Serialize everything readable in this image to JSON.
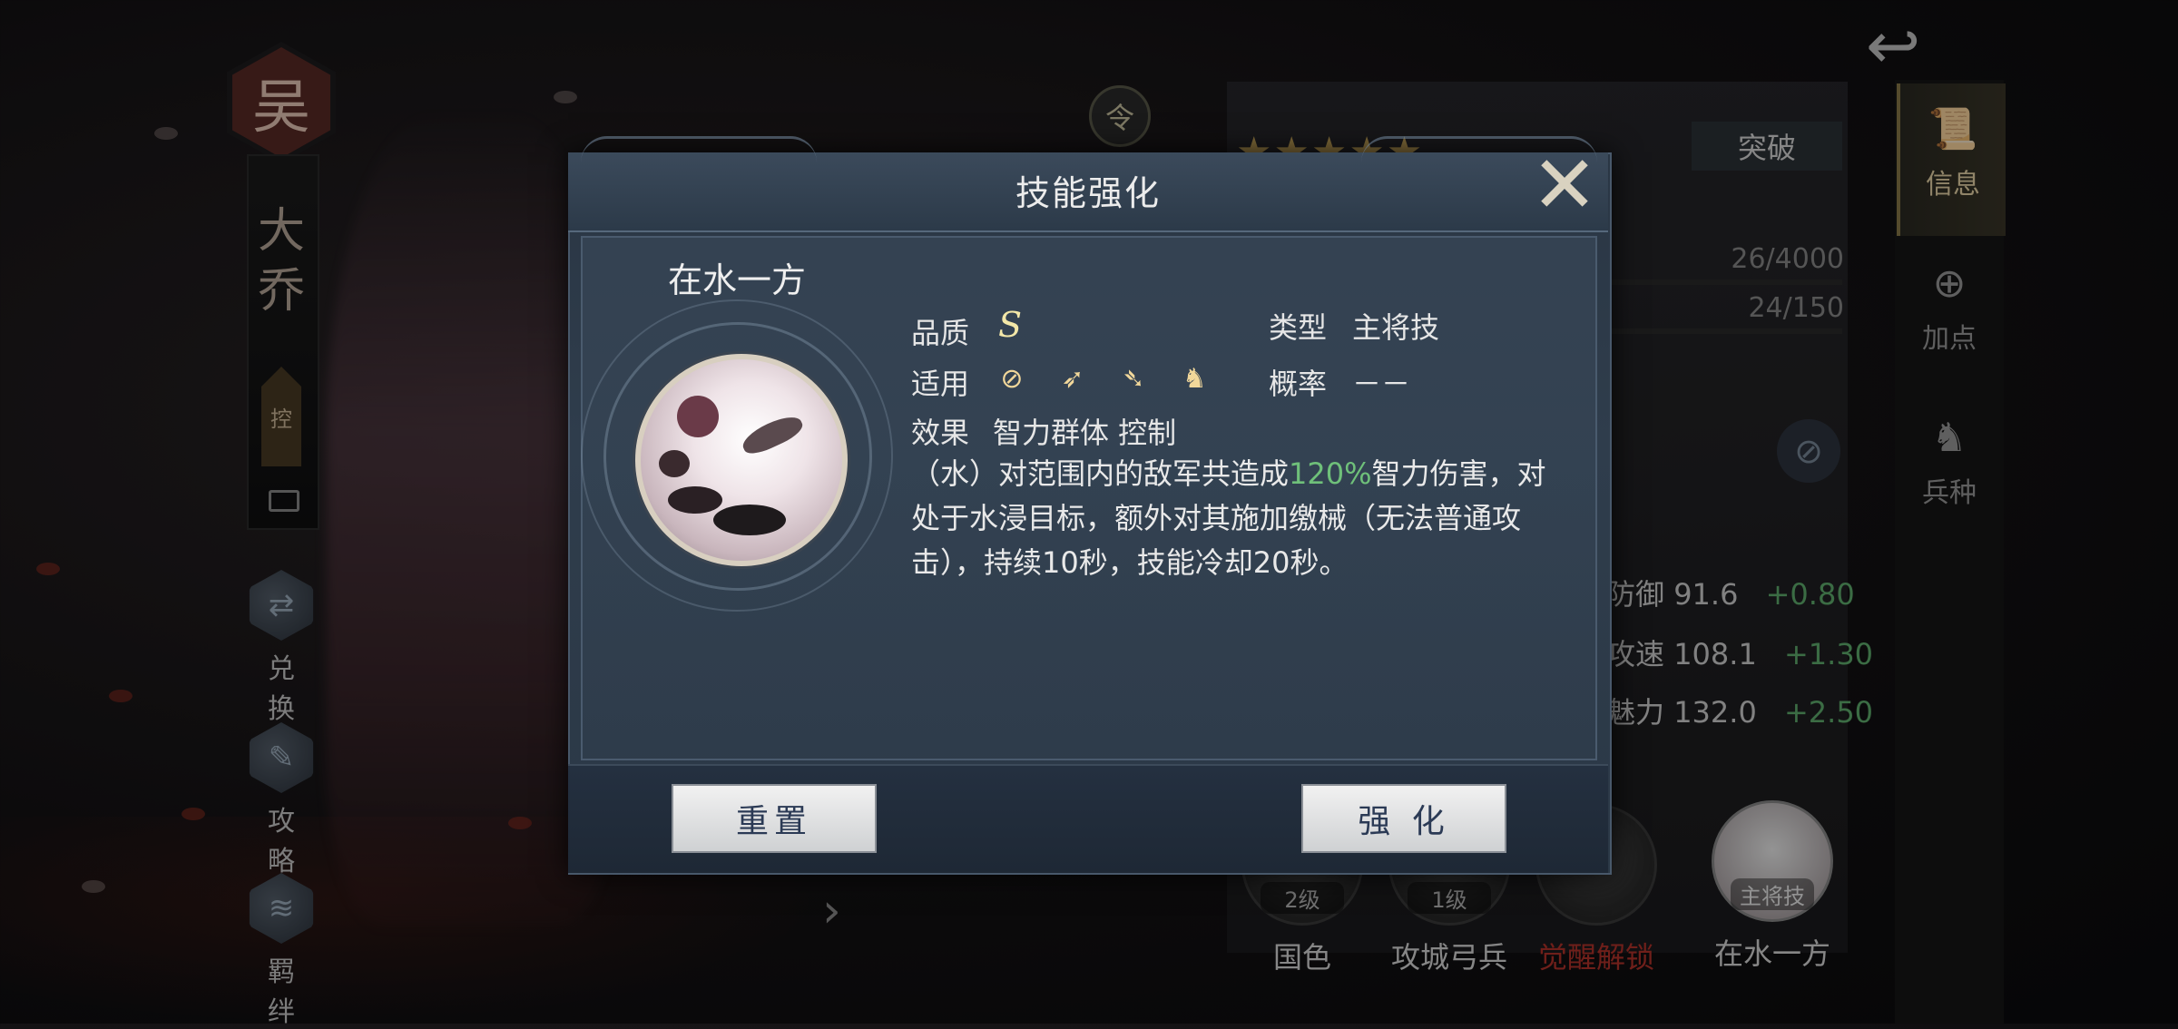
{
  "hero": {
    "faction": "吴",
    "name": "大乔",
    "role": "控",
    "name_line1": "大",
    "name_line2": "乔"
  },
  "left_nav": [
    {
      "label": "兑换",
      "icon": "exchange-icon"
    },
    {
      "label": "攻略",
      "icon": "scroll-icon"
    },
    {
      "label": "羁绊",
      "icon": "bond-icon"
    }
  ],
  "order_icon_label": "令",
  "right_panel": {
    "stars": "★★★★★",
    "breakthrough_label": "突破",
    "exp": "26/4000",
    "level_progress": "24/150",
    "attributes": [
      {
        "name": "防御",
        "value": "91.6",
        "bonus": "+0.80"
      },
      {
        "name": "攻速",
        "value": "108.1",
        "bonus": "+1.30"
      },
      {
        "name": "魅力",
        "value": "132.0",
        "bonus": "+2.50"
      }
    ],
    "skills": [
      {
        "tag": "2级",
        "label": "国色",
        "locked": false
      },
      {
        "tag": "1级",
        "label": "攻城弓兵",
        "locked": false
      },
      {
        "tag": "",
        "label": "觉醒解锁",
        "locked": true
      },
      {
        "tag": "主将技",
        "label": "在水一方",
        "locked": false
      }
    ]
  },
  "tabs": [
    {
      "label": "信息",
      "icon": "scroll-icon",
      "active": true
    },
    {
      "label": "加点",
      "icon": "points-icon",
      "active": false
    },
    {
      "label": "兵种",
      "icon": "troop-icon",
      "active": false
    }
  ],
  "modal": {
    "title": "技能强化",
    "skill_name": "在水一方",
    "quality_label": "品质",
    "quality_value": "S",
    "type_label": "类型",
    "type_value": "主将技",
    "applies_label": "适用",
    "applies_icons": [
      "shield-icon",
      "bow-icon",
      "spear-icon",
      "cavalry-icon"
    ],
    "chance_label": "概率",
    "chance_value": "－－",
    "effect_label": "效果",
    "effect_value": "智力群体 控制",
    "description_pre": "（水）对范围内的敌军共造成",
    "description_highlight": "120%",
    "description_post": "智力伤害，对处于水浸目标，额外对其施加缴械（无法普通攻击），持续10秒，技能冷却20秒。",
    "reset_label": "重置",
    "enhance_label": "强 化"
  },
  "colors": {
    "highlight_green": "#6fc07a",
    "locked_red": "#b3322a",
    "bonus_green": "#5fae6e",
    "star_gold": "#c9a65a"
  }
}
